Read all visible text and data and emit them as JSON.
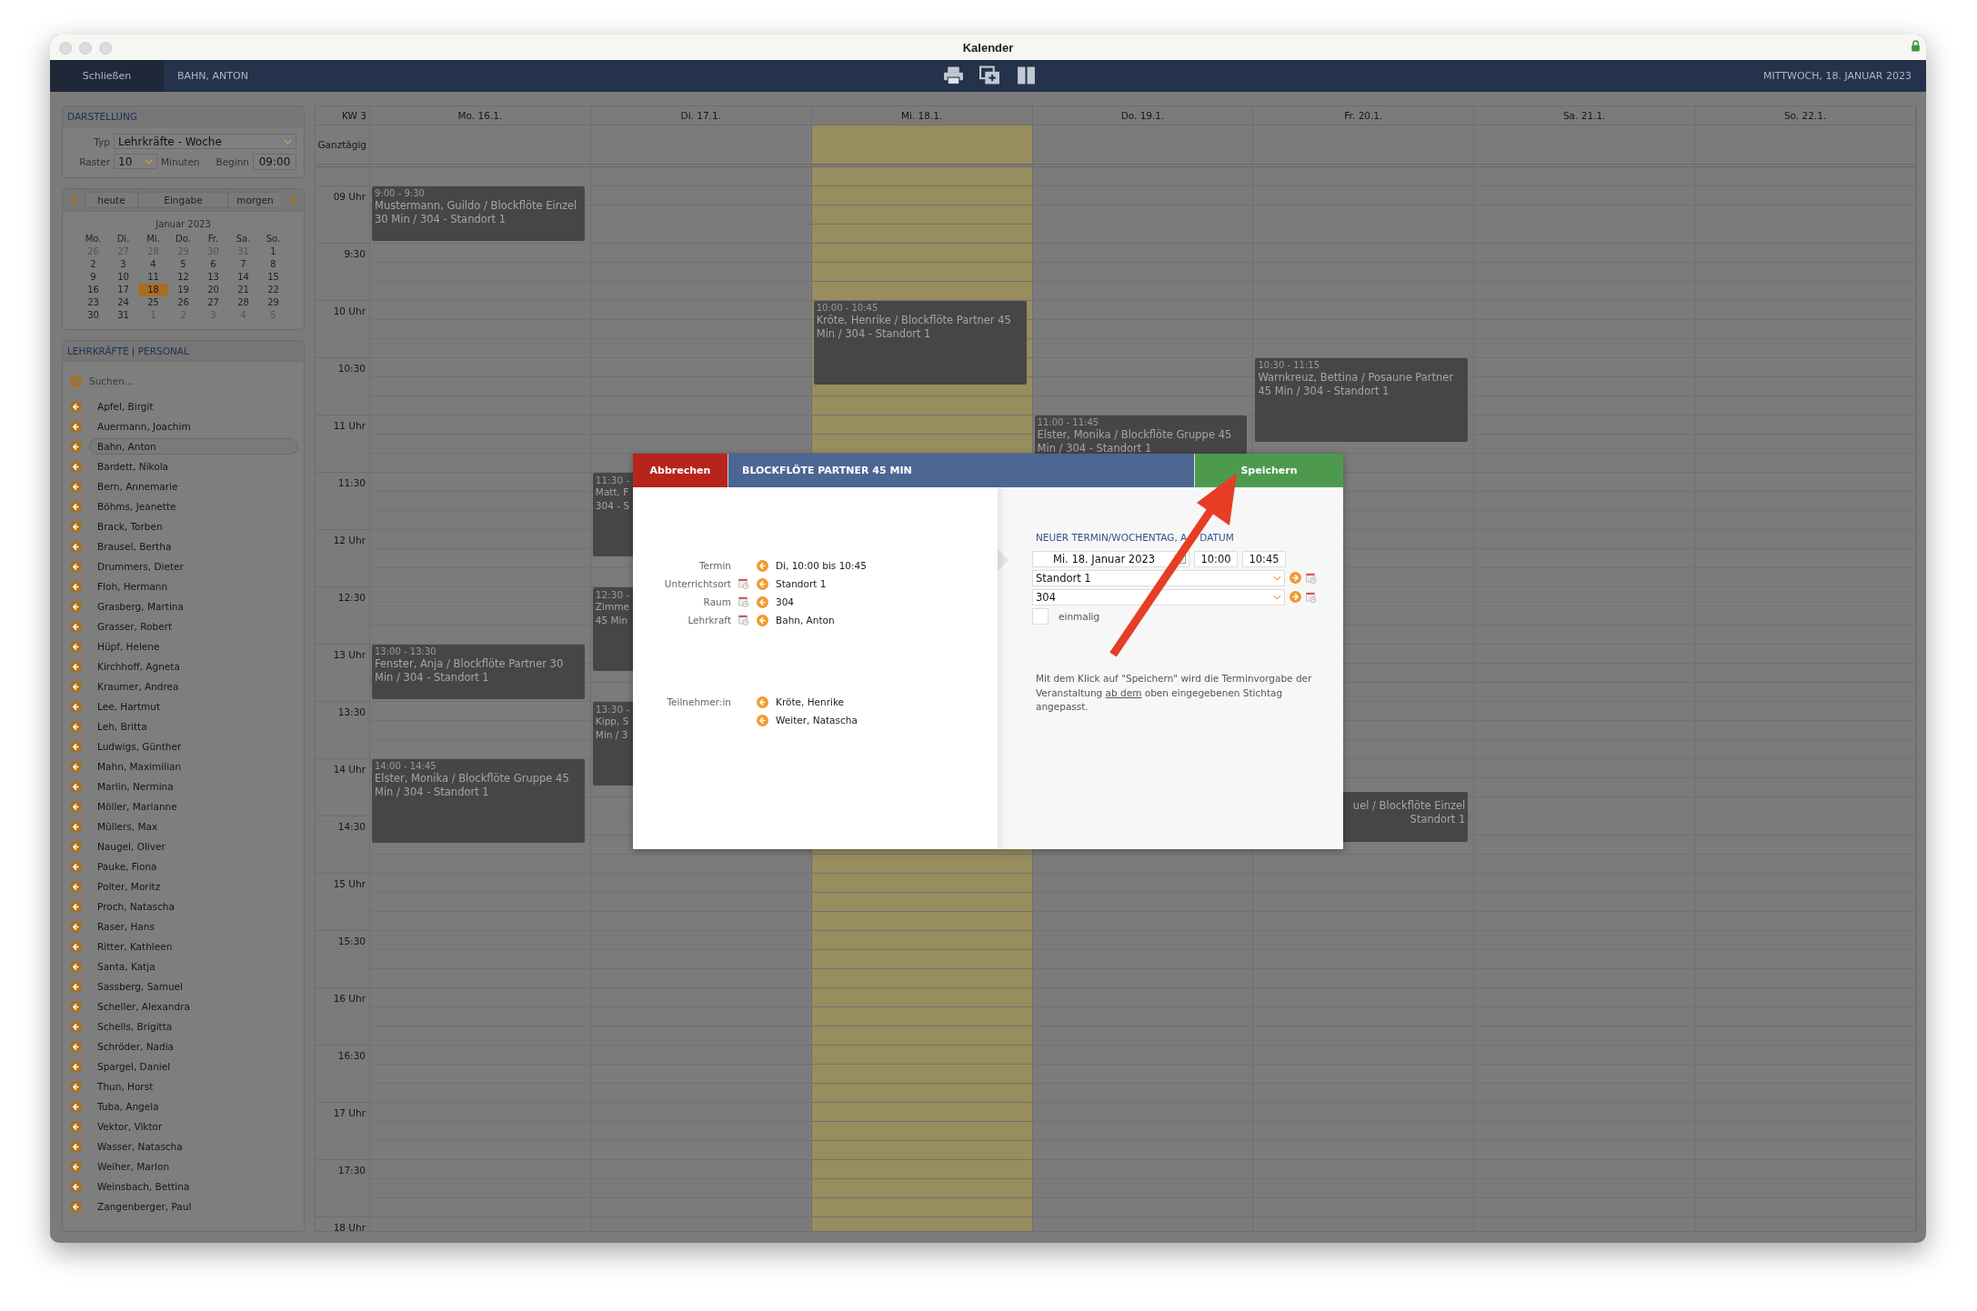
{
  "window": {
    "title": "Kalender"
  },
  "toolbar": {
    "close_button": "Schließen",
    "person": "BAHN, ANTON",
    "date": "MITTWOCH, 18. JANUAR 2023"
  },
  "display_panel": {
    "heading": "DARSTELLUNG",
    "type_label": "Typ",
    "type_value": "Lehrkräfte - Woche",
    "grid_label": "Raster",
    "grid_value": "10",
    "grid_unit": "Minuten",
    "start_label": "Beginn",
    "start_value": "09:00"
  },
  "navigator": {
    "buttons": [
      "heute",
      "Eingabe",
      "morgen"
    ],
    "month": "Januar 2023",
    "weekdays": [
      "Mo.",
      "Di.",
      "Mi.",
      "Do.",
      "Fr.",
      "Sa.",
      "So."
    ],
    "weeks": [
      [
        {
          "label": "26",
          "other_month": true,
          "selected": false
        },
        {
          "label": "27",
          "other_month": true,
          "selected": false
        },
        {
          "label": "28",
          "other_month": true,
          "selected": false
        },
        {
          "label": "29",
          "other_month": true,
          "selected": false
        },
        {
          "label": "30",
          "other_month": true,
          "selected": false
        },
        {
          "label": "31",
          "other_month": true,
          "selected": false
        },
        {
          "label": "1",
          "other_month": false,
          "selected": false
        }
      ],
      [
        {
          "label": "2",
          "other_month": false,
          "selected": false
        },
        {
          "label": "3",
          "other_month": false,
          "selected": false
        },
        {
          "label": "4",
          "other_month": false,
          "selected": false
        },
        {
          "label": "5",
          "other_month": false,
          "selected": false
        },
        {
          "label": "6",
          "other_month": false,
          "selected": false
        },
        {
          "label": "7",
          "other_month": false,
          "selected": false
        },
        {
          "label": "8",
          "other_month": false,
          "selected": false
        }
      ],
      [
        {
          "label": "9",
          "other_month": false,
          "selected": false
        },
        {
          "label": "10",
          "other_month": false,
          "selected": false
        },
        {
          "label": "11",
          "other_month": false,
          "selected": false
        },
        {
          "label": "12",
          "other_month": false,
          "selected": false
        },
        {
          "label": "13",
          "other_month": false,
          "selected": false
        },
        {
          "label": "14",
          "other_month": false,
          "selected": false
        },
        {
          "label": "15",
          "other_month": false,
          "selected": false
        }
      ],
      [
        {
          "label": "16",
          "other_month": false,
          "selected": false
        },
        {
          "label": "17",
          "other_month": false,
          "selected": false
        },
        {
          "label": "18",
          "other_month": false,
          "selected": true
        },
        {
          "label": "19",
          "other_month": false,
          "selected": false
        },
        {
          "label": "20",
          "other_month": false,
          "selected": false
        },
        {
          "label": "21",
          "other_month": false,
          "selected": false
        },
        {
          "label": "22",
          "other_month": false,
          "selected": false
        }
      ],
      [
        {
          "label": "23",
          "other_month": false,
          "selected": false
        },
        {
          "label": "24",
          "other_month": false,
          "selected": false
        },
        {
          "label": "25",
          "other_month": false,
          "selected": false
        },
        {
          "label": "26",
          "other_month": false,
          "selected": false
        },
        {
          "label": "27",
          "other_month": false,
          "selected": false
        },
        {
          "label": "28",
          "other_month": false,
          "selected": false
        },
        {
          "label": "29",
          "other_month": false,
          "selected": false
        }
      ],
      [
        {
          "label": "30",
          "other_month": false,
          "selected": false
        },
        {
          "label": "31",
          "other_month": false,
          "selected": false
        },
        {
          "label": "1",
          "other_month": true,
          "selected": false
        },
        {
          "label": "2",
          "other_month": true,
          "selected": false
        },
        {
          "label": "3",
          "other_month": true,
          "selected": false
        },
        {
          "label": "4",
          "other_month": true,
          "selected": false
        },
        {
          "label": "5",
          "other_month": true,
          "selected": false
        }
      ]
    ]
  },
  "people_panel": {
    "heading": "LEHRKRÄFTE | PERSONAL",
    "search_placeholder": "Suchen...",
    "items": [
      {
        "name": "Apfel, Birgit",
        "selected": false
      },
      {
        "name": "Auermann, Joachim",
        "selected": false
      },
      {
        "name": "Bahn, Anton",
        "selected": true
      },
      {
        "name": "Bardett, Nikola",
        "selected": false
      },
      {
        "name": "Bern, Annemarie",
        "selected": false
      },
      {
        "name": "Böhms, Jeanette",
        "selected": false
      },
      {
        "name": "Brack, Torben",
        "selected": false
      },
      {
        "name": "Brausel, Bertha",
        "selected": false
      },
      {
        "name": "Drummers, Dieter",
        "selected": false
      },
      {
        "name": "Floh, Hermann",
        "selected": false
      },
      {
        "name": "Grasberg, Martina",
        "selected": false
      },
      {
        "name": "Grasser, Robert",
        "selected": false
      },
      {
        "name": "Hüpf, Helene",
        "selected": false
      },
      {
        "name": "Kirchhoff, Agneta",
        "selected": false
      },
      {
        "name": "Kraumer, Andrea",
        "selected": false
      },
      {
        "name": "Lee, Hartmut",
        "selected": false
      },
      {
        "name": "Leh, Britta",
        "selected": false
      },
      {
        "name": "Ludwigs, Günther",
        "selected": false
      },
      {
        "name": "Mahn, Maximilian",
        "selected": false
      },
      {
        "name": "Marlin, Nermina",
        "selected": false
      },
      {
        "name": "Möller, Marianne",
        "selected": false
      },
      {
        "name": "Müllers, Max",
        "selected": false
      },
      {
        "name": "Naugel, Oliver",
        "selected": false
      },
      {
        "name": "Pauke, Fiona",
        "selected": false
      },
      {
        "name": "Polter, Moritz",
        "selected": false
      },
      {
        "name": "Proch, Natascha",
        "selected": false
      },
      {
        "name": "Raser, Hans",
        "selected": false
      },
      {
        "name": "Ritter, Kathleen",
        "selected": false
      },
      {
        "name": "Santa, Katja",
        "selected": false
      },
      {
        "name": "Sassberg, Samuel",
        "selected": false
      },
      {
        "name": "Scheller, Alexandra",
        "selected": false
      },
      {
        "name": "Schells, Brigitta",
        "selected": false
      },
      {
        "name": "Schröder, Nadia",
        "selected": false
      },
      {
        "name": "Spargel, Daniel",
        "selected": false
      },
      {
        "name": "Thun, Horst",
        "selected": false
      },
      {
        "name": "Tuba, Angela",
        "selected": false
      },
      {
        "name": "Vektor, Viktor",
        "selected": false
      },
      {
        "name": "Wasser, Natascha",
        "selected": false
      },
      {
        "name": "Weiher, Marlon",
        "selected": false
      },
      {
        "name": "Weinsbach, Bettina",
        "selected": false
      },
      {
        "name": "Zangenberger, Paul",
        "selected": false
      }
    ]
  },
  "calendar": {
    "week": "KW 3",
    "allday_label": "Ganztägig",
    "times": [
      "09 Uhr",
      "9:30",
      "10 Uhr",
      "10:30",
      "11 Uhr",
      "11:30",
      "12 Uhr",
      "12:30",
      "13 Uhr",
      "13:30",
      "14 Uhr",
      "14:30",
      "15 Uhr",
      "15:30",
      "16 Uhr",
      "16:30",
      "17 Uhr",
      "17:30",
      "18 Uhr"
    ],
    "days": [
      {
        "label": "Mo. 16.1.",
        "today": false,
        "events": [
          {
            "kind": "full",
            "time": "9:00 - 9:30",
            "text": "Mustermann, Guildo / Blockflöte Einzel 30 Min / 304 - Standort 1"
          },
          {
            "kind": "full",
            "time": "13:00 - 13:30",
            "text": "Fenster, Anja / Blockflöte Partner 30 Min / 304 - Standort 1"
          },
          {
            "kind": "full",
            "time": "14:00 - 14:45",
            "text": "Elster, Monika / Blockflöte Gruppe 45 Min / 304 - Standort 1"
          }
        ]
      },
      {
        "label": "Di. 17.1.",
        "today": false,
        "events": [
          {
            "kind": "covered-right",
            "time": "11:30 -",
            "lines": [
              "Matt, F",
              "304 - S"
            ]
          },
          {
            "kind": "covered-right",
            "time": "12:30 -",
            "lines": [
              "Zimme",
              "45 Min"
            ]
          },
          {
            "kind": "covered-right",
            "time": "13:30 -",
            "lines": [
              "Kipp, S",
              "Min / 3"
            ]
          }
        ]
      },
      {
        "label": "Mi. 18.1.",
        "today": true,
        "events": [
          {
            "kind": "full",
            "time": "10:00 - 10:45",
            "text": "Kröte, Henrike / Blockflöte Partner 45 Min / 304 - Standort 1"
          }
        ]
      },
      {
        "label": "Do. 19.1.",
        "today": false,
        "events": [
          {
            "kind": "full",
            "time": "11:00 - 11:45",
            "text": "Elster, Monika / Blockflöte Gruppe 45 Min / 304 - Standort 1"
          }
        ]
      },
      {
        "label": "Fr. 20.1.",
        "today": false,
        "events": [
          {
            "kind": "full",
            "time": "10:30 - 11:15",
            "text": "Warnkreuz, Bettina / Posaune Partner 45 Min / 304 - Standort 1"
          },
          {
            "kind": "covered-left",
            "lines": [
              "uel / Blockflöte Einzel",
              "Standort 1"
            ]
          }
        ]
      },
      {
        "label": "Sa. 21.1.",
        "today": false
      },
      {
        "label": "So. 22.1.",
        "today": false
      }
    ]
  },
  "dialog": {
    "cancel_button": "Abbrechen",
    "title": "BLOCKFLÖTE PARTNER 45 MIN",
    "save_button": "Speichern",
    "details": [
      {
        "label": "Termin",
        "calendar_icon": false,
        "value": "Di, 10:00 bis 10:45"
      },
      {
        "label": "Unterrichtsort",
        "calendar_icon": true,
        "value": "Standort 1"
      },
      {
        "label": "Raum",
        "calendar_icon": true,
        "value": "304"
      },
      {
        "label": "Lehrkraft",
        "calendar_icon": true,
        "value": "Bahn, Anton"
      }
    ],
    "participants_label": "Teilnehmer:in",
    "participants": [
      "Kröte, Henrike",
      "Weiter, Natascha"
    ],
    "new_heading_start": "NEUER TERMIN/WOCHENTAG, A",
    "new_heading_end": "DATUM",
    "date_value": "Mi. 18. Januar 2023",
    "start_time": "10:00",
    "end_time": "10:45",
    "location_value": "Standort 1",
    "room_value": "304",
    "once_label": "einmalig",
    "once_checked": false,
    "note": {
      "before": "Mit dem Klick auf \"Speichern\" wird die Terminvorgabe der Veranstaltung ",
      "link": "ab dem",
      "after": " oben eingegebenen Stichtag angepasst."
    }
  }
}
